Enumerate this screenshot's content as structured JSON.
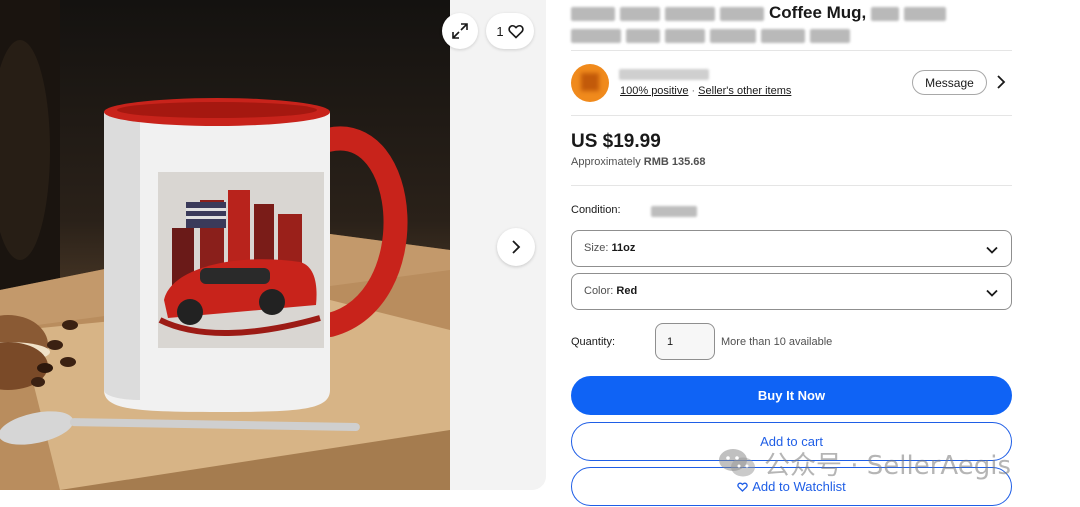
{
  "gallery": {
    "like_count": "1",
    "icons": {
      "expand": "expand-arrows-icon",
      "heart": "heart-outline-icon",
      "next": "chevron-right-icon"
    }
  },
  "listing": {
    "title_visible": "Coffee Mug,"
  },
  "seller": {
    "feedback": "100% positive",
    "separator": "·",
    "other_items": "Seller's other items",
    "message_label": "Message"
  },
  "pricing": {
    "price": "US $19.99",
    "approx_prefix": "Approximately",
    "approx_value": "RMB 135.68"
  },
  "condition": {
    "label": "Condition:"
  },
  "variations": [
    {
      "label": "Size:",
      "value": "11oz"
    },
    {
      "label": "Color:",
      "value": "Red"
    }
  ],
  "quantity": {
    "label": "Quantity:",
    "value": "1",
    "availability": "More than 10 available"
  },
  "actions": {
    "buy_now": "Buy It Now",
    "add_to_cart": "Add to cart",
    "watchlist": "Add to Watchlist"
  },
  "watermark": {
    "text": "公众号 · SellerAegis"
  },
  "colors": {
    "primary": "#0f63f5",
    "link_blue": "#1f5ee6",
    "seller_orange": "#f08a1c",
    "mug_red": "#c8231b"
  }
}
